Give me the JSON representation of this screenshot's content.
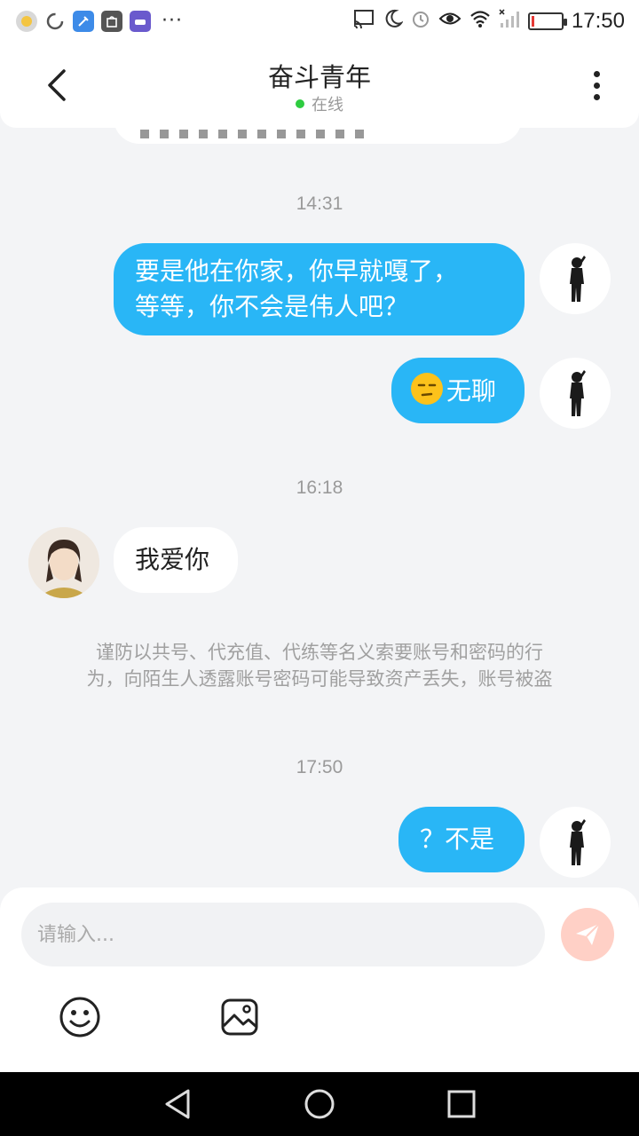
{
  "status_bar": {
    "time": "17:50",
    "left_icons": [
      "notification-app-icon",
      "loading-icon",
      "cleaner-app-icon",
      "shopping-bag-icon",
      "game-app-icon"
    ],
    "overflow": "···",
    "right_icons": [
      "cast-icon",
      "moon-icon",
      "alarm-icon",
      "eye-icon",
      "wifi-icon",
      "signal-icon",
      "battery-icon"
    ],
    "battery_level": 0.1
  },
  "header": {
    "title": "奋斗青年",
    "status": "在线",
    "status_color": "#2ecc40"
  },
  "chat": {
    "timestamps": [
      "14:31",
      "16:18",
      "17:50"
    ],
    "messages": [
      {
        "direction": "out",
        "lines": [
          "要是他在你家，你早就嘎了，",
          "等等，你不会是伟人吧？"
        ]
      },
      {
        "direction": "out",
        "emoji": "unamused-face-icon",
        "text": "无聊"
      },
      {
        "direction": "in",
        "text": "我爱你"
      },
      {
        "direction": "out",
        "text": "？不是"
      }
    ],
    "notice_lines": [
      "谨防以共号、代充值、代练等名义索要账号和密码的行",
      "为，向陌生人透露账号密码可能导致资产丢失，账号被盗"
    ]
  },
  "input": {
    "placeholder": "请输入..."
  },
  "toolbar_icons": [
    "smiley-icon",
    "image-icon",
    "send-icon"
  ],
  "colors": {
    "outgoing_bubble": "#29b6f6",
    "incoming_bubble": "#ffffff",
    "background": "#f3f4f6",
    "send_button": "#ffd0c6"
  }
}
